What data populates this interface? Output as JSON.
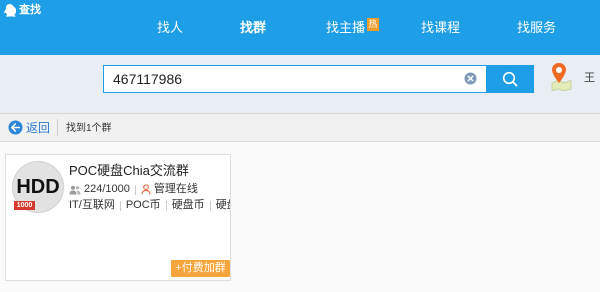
{
  "window": {
    "title": "查找",
    "icon": "qq-penguin-icon"
  },
  "nav": {
    "tabs": [
      {
        "label": "找人",
        "active": false
      },
      {
        "label": "找群",
        "active": true
      },
      {
        "label": "找主播",
        "active": false,
        "badge": "热"
      },
      {
        "label": "找课程",
        "active": false
      },
      {
        "label": "找服务",
        "active": false
      }
    ]
  },
  "search": {
    "value": "467117986",
    "clear_icon": "clear-icon",
    "button_icon": "search-icon"
  },
  "location": {
    "icon": "map-pin-icon",
    "label": "王"
  },
  "toolbar": {
    "back_icon": "back-arrow-icon",
    "back_label": "返回",
    "result_text": "找到1个群"
  },
  "results": [
    {
      "avatar_text": "HDD",
      "avatar_badge": "1000",
      "name": "POC硬盘Chia交流群",
      "members_icon": "members-icon",
      "members": "224/1000",
      "admin_icon": "admin-icon",
      "admin_status": "管理在线",
      "tags": [
        "IT/互联网",
        "POC币",
        "硬盘币",
        "硬盘..."
      ],
      "join_label": "+付费加群"
    }
  ],
  "colors": {
    "accent": "#1d9ee6",
    "search_area_bg": "#e8eef3",
    "hot_badge": "#f39c2b",
    "avatar_badge": "#d73a2f",
    "join_button": "#f5a53c",
    "link": "#2b7cd3"
  }
}
